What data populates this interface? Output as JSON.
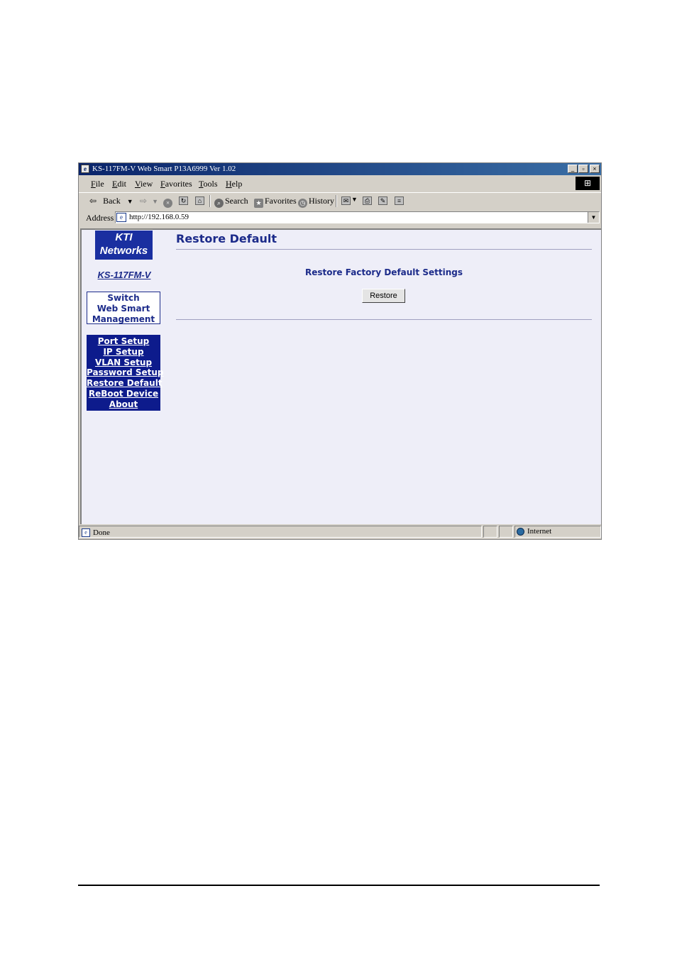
{
  "window": {
    "title": "KS-117FM-V  Web Smart P13A6999 Ver 1.02",
    "min_symbol": "_",
    "max_symbol": "▫",
    "close_symbol": "×"
  },
  "menubar": {
    "items": [
      "File",
      "Edit",
      "View",
      "Favorites",
      "Tools",
      "Help"
    ]
  },
  "toolbar": {
    "back_label": "Back",
    "search_label": "Search",
    "favorites_label": "Favorites",
    "history_label": "History"
  },
  "address": {
    "label": "Address",
    "url": "http://192.168.0.59"
  },
  "sidebar": {
    "logo_line1": "KTI",
    "logo_line2": "Networks",
    "model": "KS-117FM-V",
    "product_line1": "Switch",
    "product_line2": "Web Smart",
    "product_line3": "Management",
    "nav": [
      {
        "label": "Port Setup"
      },
      {
        "label": "IP Setup"
      },
      {
        "label": "VLAN Setup"
      },
      {
        "label": "Password Setup"
      },
      {
        "label": "Restore Default"
      },
      {
        "label": "ReBoot Device"
      },
      {
        "label": "About"
      }
    ]
  },
  "main": {
    "title": "Restore Default",
    "section_label": "Restore Factory Default Settings",
    "restore_button": "Restore"
  },
  "statusbar": {
    "status": "Done",
    "zone": "Internet"
  },
  "colors": {
    "nav_bg": "#0d1b8c",
    "link": "#1c2b8a",
    "page_bg": "#eeeef8"
  }
}
